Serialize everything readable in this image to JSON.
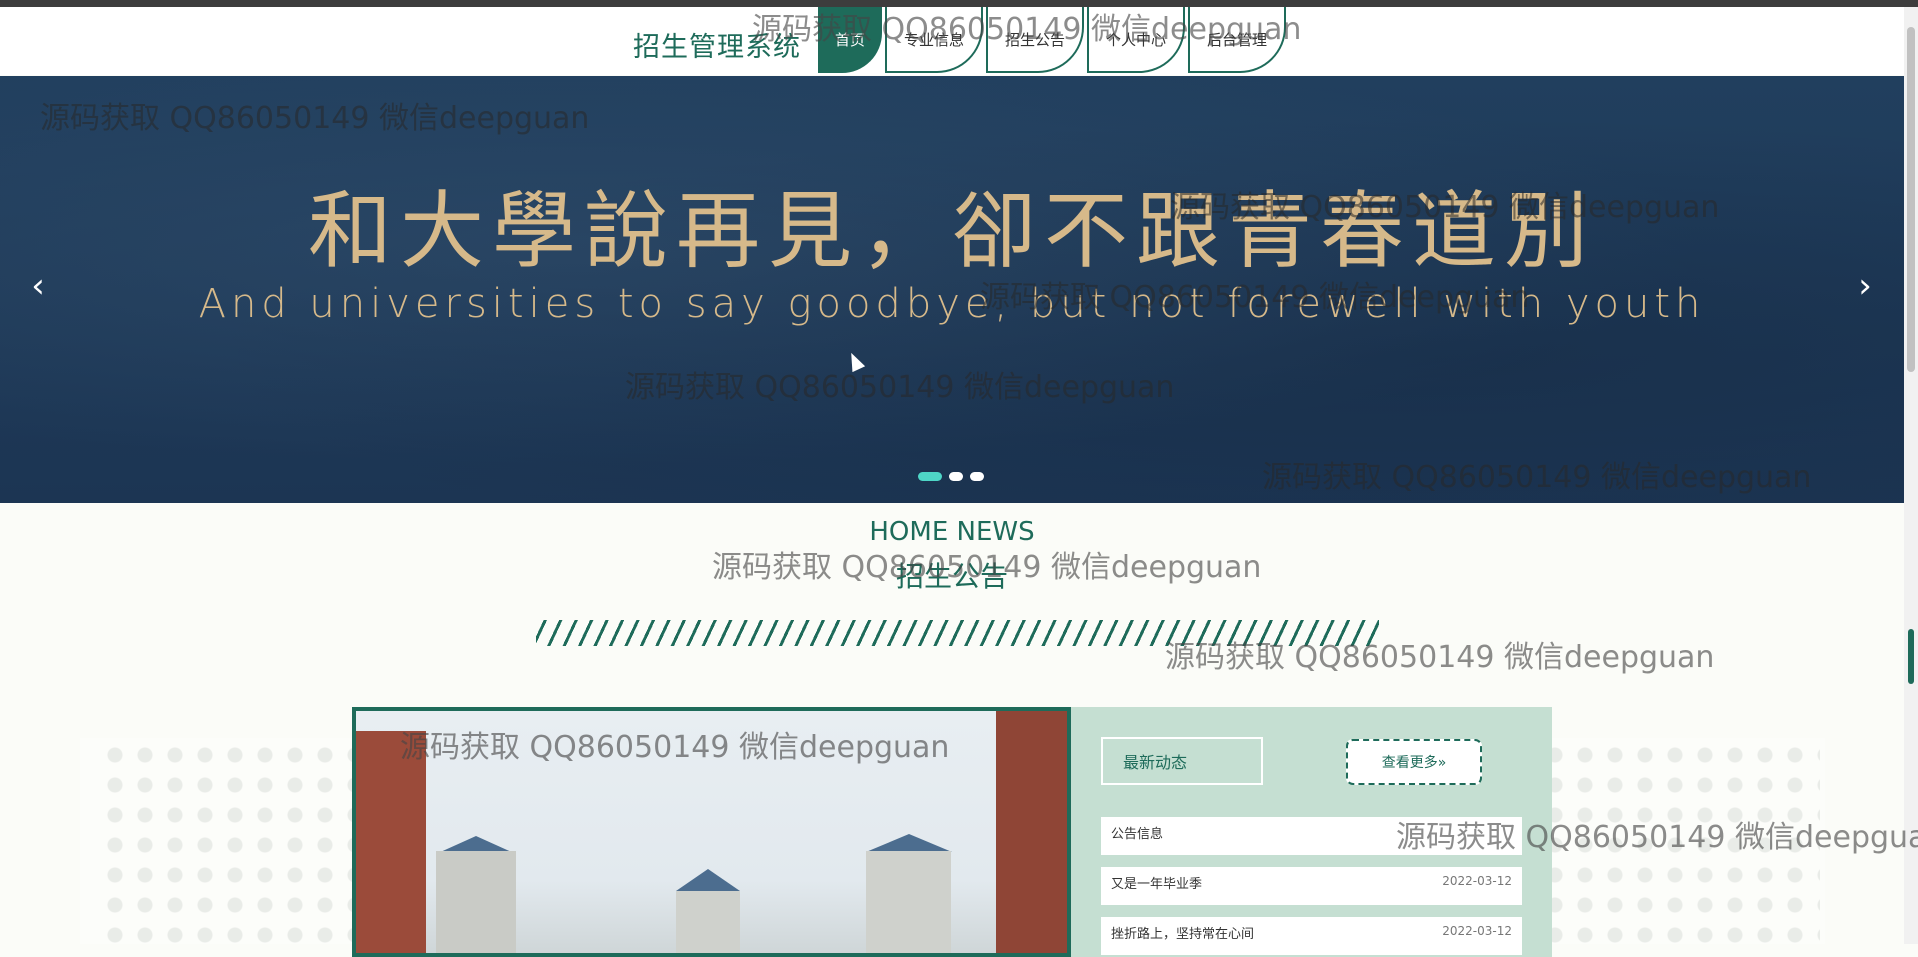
{
  "header": {
    "brand": "招生管理系统",
    "nav": [
      "首页",
      "专业信息",
      "招生公告",
      "个人中心",
      "后台管理"
    ]
  },
  "banner": {
    "title_zh": "和大學說再見，卻不跟青春道別",
    "title_en": "And universities to say goodbye, but not forewell with youth",
    "prev_glyph": "‹",
    "next_glyph": "›",
    "slide_count": 3,
    "active_slide": 1
  },
  "section": {
    "title_en": "HOME NEWS",
    "title_zh": "招生公告"
  },
  "news": {
    "latest_label": "最新动态",
    "more_label": "查看更多»",
    "items": [
      {
        "title": "公告信息",
        "date": ""
      },
      {
        "title": "又是一年毕业季",
        "date": "2022-03-12"
      },
      {
        "title": "挫折路上，坚持常在心间",
        "date": "2022-03-12"
      }
    ]
  },
  "watermark": "源码获取 QQ86050149 微信deepguan",
  "colors": {
    "brand": "#1e6b5a",
    "banner_bg": "#1f3a59",
    "banner_text": "#d6b98a",
    "panel_bg": "#c5dfd2",
    "dot_active": "#4ed6c7"
  }
}
